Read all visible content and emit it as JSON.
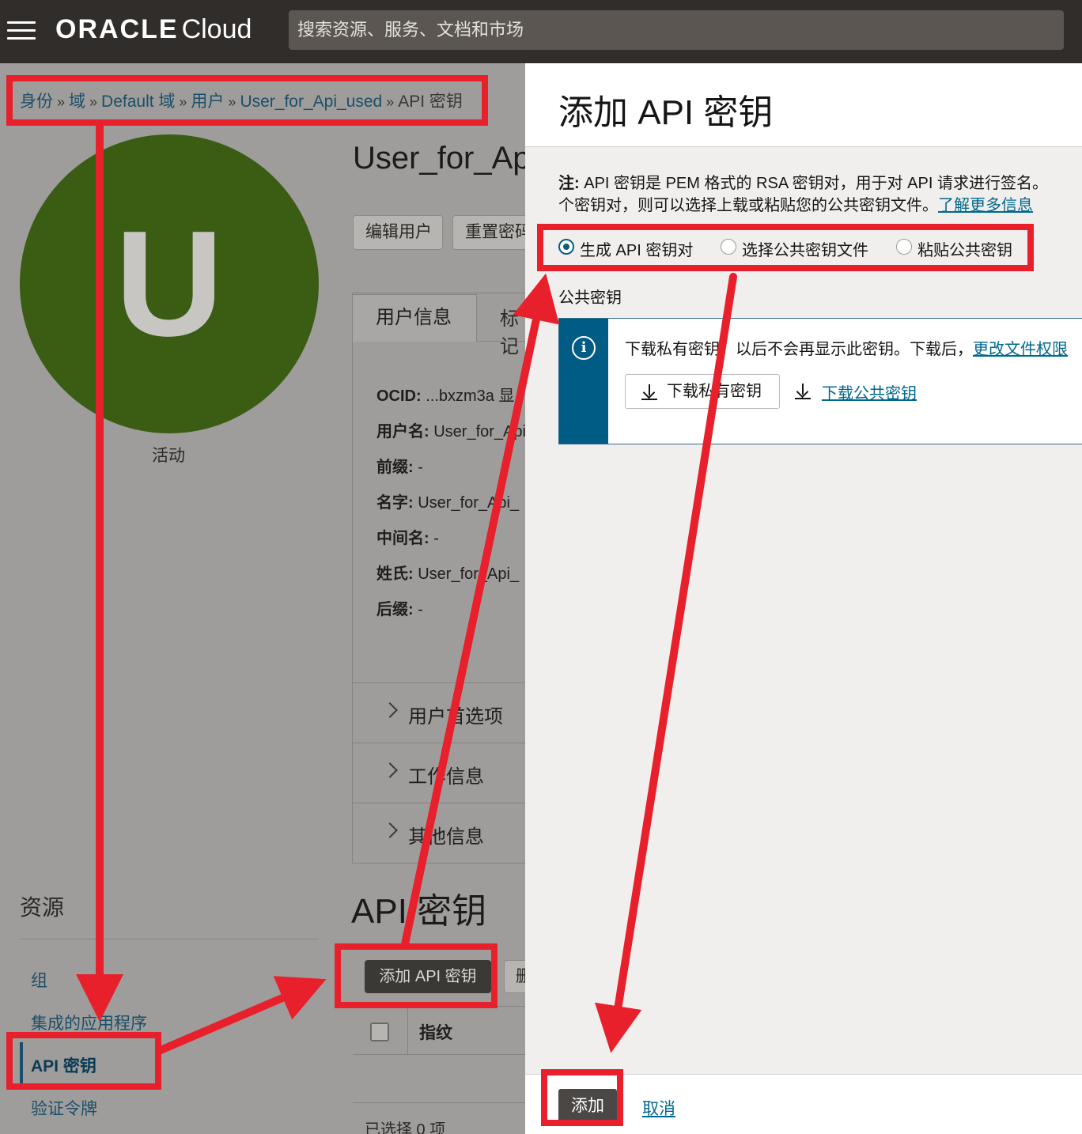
{
  "topbar": {
    "brand_oracle": "ORACLE",
    "brand_cloud": "Cloud",
    "search_placeholder": "搜索资源、服务、文档和市场"
  },
  "breadcrumbs": [
    "身份",
    "域",
    "Default 域",
    "用户",
    "User_for_Api_used",
    "API 密钥"
  ],
  "user": {
    "avatar_letter": "U",
    "status": "活动",
    "title": "User_for_Ap",
    "buttons": [
      "编辑用户",
      "重置密码"
    ],
    "tabs": [
      "用户信息",
      "标记"
    ],
    "fields": [
      {
        "label": "OCID:",
        "value": " ...bxzm3a 显"
      },
      {
        "label": "用户名:",
        "value": " User_for_Api"
      },
      {
        "label": "前缀:",
        "value": " -"
      },
      {
        "label": "名字:",
        "value": " User_for_Api_"
      },
      {
        "label": "中间名:",
        "value": " -"
      },
      {
        "label": "姓氏:",
        "value": " User_for_Api_"
      },
      {
        "label": "后缀:",
        "value": " -"
      }
    ],
    "accordions": [
      "用户首选项",
      "工作信息",
      "其他信息"
    ]
  },
  "resources": {
    "title": "资源",
    "items": [
      "组",
      "集成的应用程序",
      "API 密钥",
      "验证令牌"
    ],
    "active": "API 密钥"
  },
  "api_keys": {
    "title": "API 密钥",
    "add_button": "添加 API 密钥",
    "delete_button": "删除",
    "column_fingerprint": "指纹",
    "selected_text": "已选择 0 项"
  },
  "drawer": {
    "title": "添加 API 密钥",
    "note_label": "注:",
    "note_line1": " API 密钥是 PEM 格式的 RSA 密钥对，用于对 API 请求进行签名。",
    "note_line2": "个密钥对，则可以选择上载或粘贴您的公共密钥文件。",
    "learn_more": "了解更多信息",
    "options": [
      "生成 API 密钥对",
      "选择公共密钥文件",
      "粘贴公共密钥"
    ],
    "selected_option": "生成 API 密钥对",
    "public_key_label": "公共密钥",
    "notice_text": "下载私有密钥。以后不会再显示此密钥。下载后，",
    "notice_link": "更改文件权限",
    "download_private": "下载私有密钥",
    "download_public": "下载公共密钥",
    "add_button": "添加",
    "cancel_link": "取消"
  },
  "colors": {
    "topbar": "#312d2a",
    "avatar": "#3a5d13",
    "link": "#00688c",
    "notice_side": "#005b85",
    "annotation": "#e8202b"
  }
}
